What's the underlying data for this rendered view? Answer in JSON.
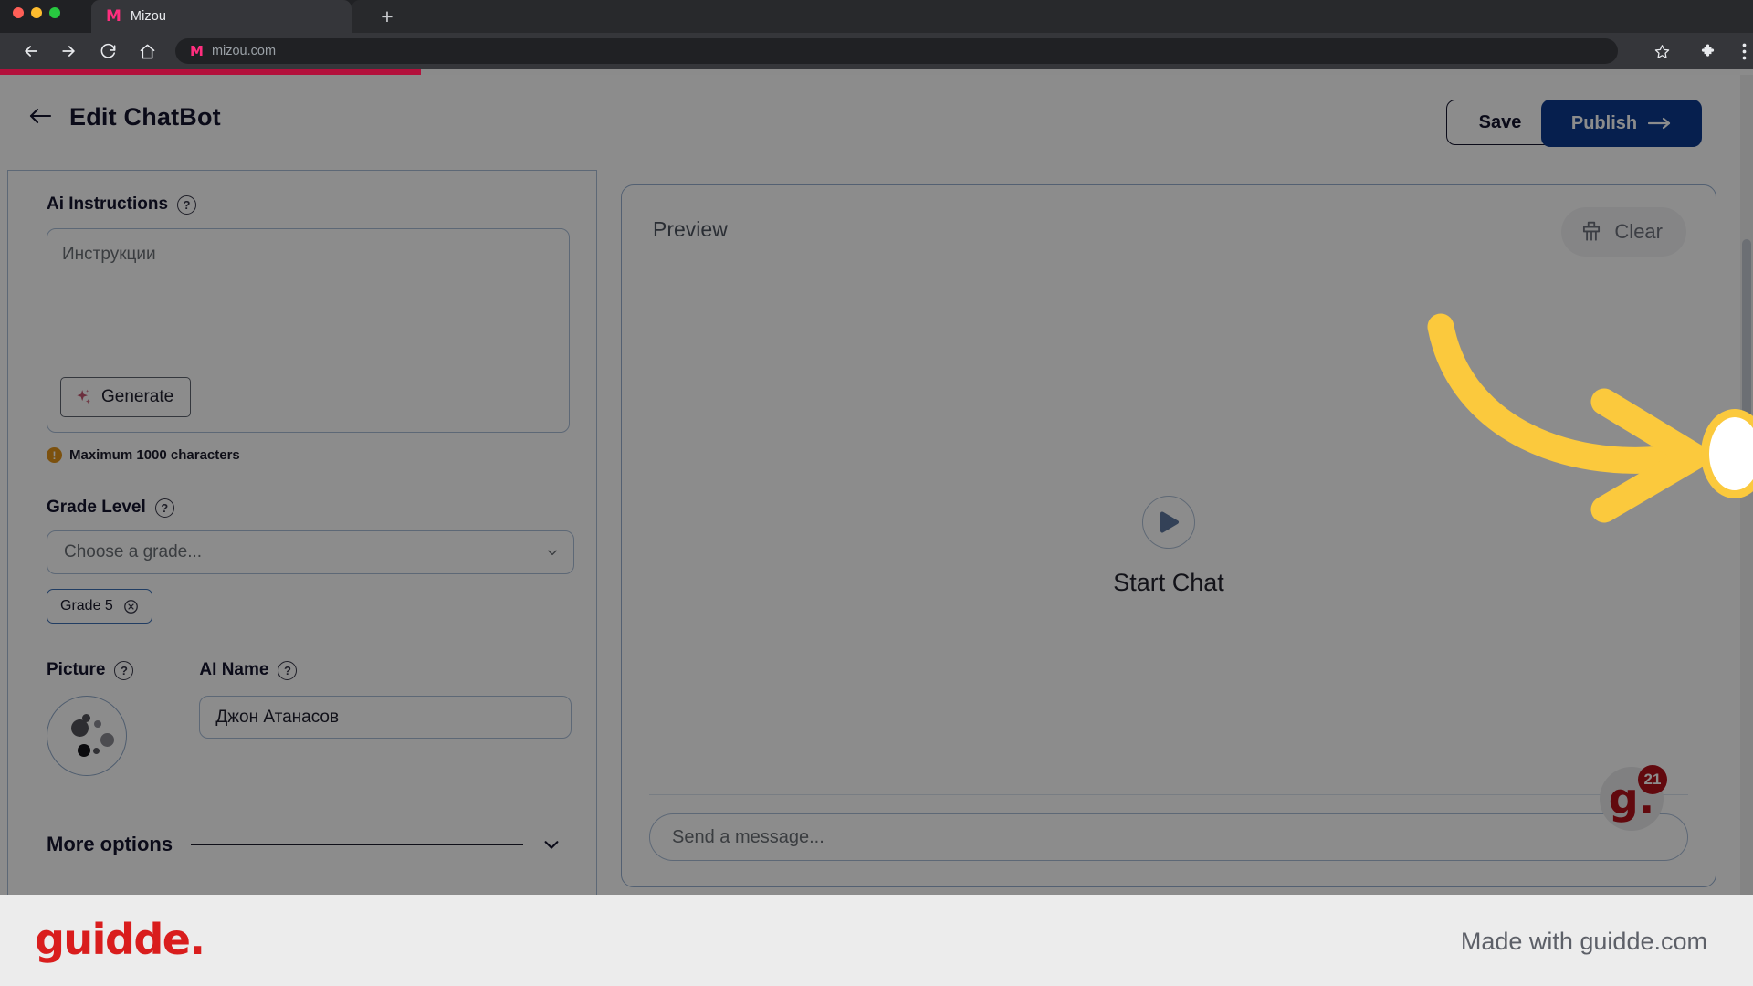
{
  "browser": {
    "tab": {
      "title": "Mizou",
      "favicon_icon": "mizou-m-icon"
    },
    "new_tab_label": "+",
    "nav": {
      "back_icon": "arrow-left-icon",
      "forward_icon": "arrow-right-icon",
      "reload_icon": "reload-icon",
      "home_icon": "home-icon"
    },
    "omnibox": {
      "url": "mizou.com",
      "site_icon": "mizou-m-icon"
    },
    "toolbar_icons": [
      "star-icon",
      "extensions-puzzle-icon",
      "overflow-menu-icon"
    ],
    "progress_percent": 24
  },
  "header": {
    "back_icon": "back-arrow-icon",
    "title": "Edit ChatBot",
    "save_label": "Save",
    "publish_label": "Publish",
    "publish_arrow": "→"
  },
  "form": {
    "ai_instructions": {
      "label": "Ai Instructions",
      "help_icon": "help-circle-icon",
      "placeholder": "Инструкции",
      "value": "",
      "generate_label": "Generate",
      "generate_icon": "sparkle-icon",
      "max_chars_note": "Maximum 1000 characters",
      "warning_icon": "warning-icon"
    },
    "grade_level": {
      "label": "Grade Level",
      "help_icon": "help-circle-icon",
      "placeholder": "Choose a grade...",
      "dropdown_icon": "chevron-down-icon",
      "chips": [
        {
          "label": "Grade 5",
          "remove_icon": "remove-circle-icon"
        }
      ]
    },
    "picture": {
      "label": "Picture",
      "help_icon": "help-circle-icon",
      "avatar_icon": "abstract-dots-avatar"
    },
    "ai_name": {
      "label": "AI Name",
      "help_icon": "help-circle-icon",
      "value": "Джон Атанасов",
      "placeholder": "AI Name"
    },
    "more_options": {
      "label": "More options",
      "chevron_icon": "chevron-down-icon"
    }
  },
  "preview": {
    "title": "Preview",
    "clear_label": "Clear",
    "clear_icon": "broom-icon",
    "start_chat_label": "Start Chat",
    "play_icon": "play-icon",
    "composer_placeholder": "Send a message...",
    "guidde_badge": {
      "logo_text": "g.",
      "count": "21"
    }
  },
  "annotation": {
    "arrow_icon": "curved-arrow-right-icon",
    "arrow_color": "#fbc93d",
    "highlight_target": "page-scrollbar"
  },
  "footer": {
    "logo_text": "guidde.",
    "made_with": "Made with guidde.com"
  },
  "colors": {
    "publish_blue": "#0b3a8f",
    "accent_yellow": "#fbc93d",
    "guidde_red": "#d91d1d",
    "warning_orange": "#e2941b",
    "chip_border": "#3c6fb5"
  }
}
